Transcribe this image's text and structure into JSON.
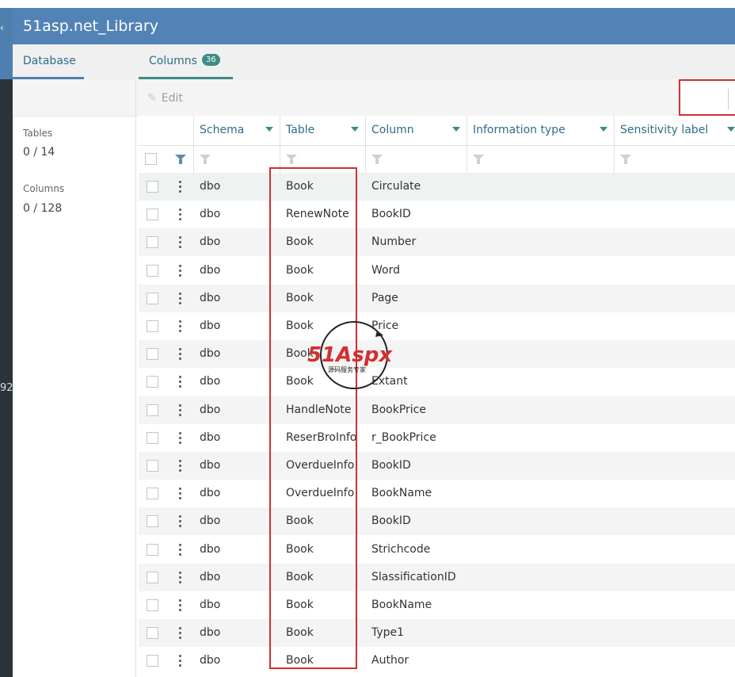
{
  "app": {
    "title": "51asp.net_Library"
  },
  "leftbar": {
    "chevron": "‹",
    "partial_number": "92"
  },
  "tabs": [
    {
      "label": "Database"
    },
    {
      "label": "Columns",
      "badge": "36"
    }
  ],
  "sidebar": {
    "tables_label": "Tables",
    "tables_value": "0 / 14",
    "columns_label": "Columns",
    "columns_value": "0 / 128"
  },
  "toolbar": {
    "edit_label": "Edit"
  },
  "grid": {
    "headers": [
      "Schema",
      "Table",
      "Column",
      "Information type",
      "Sensitivity label"
    ],
    "rows": [
      {
        "schema": "dbo",
        "table": "Book",
        "column": "Circulate"
      },
      {
        "schema": "dbo",
        "table": "RenewNote",
        "column": "BookID"
      },
      {
        "schema": "dbo",
        "table": "Book",
        "column": "Number"
      },
      {
        "schema": "dbo",
        "table": "Book",
        "column": "Word"
      },
      {
        "schema": "dbo",
        "table": "Book",
        "column": "Page"
      },
      {
        "schema": "dbo",
        "table": "Book",
        "column": "Price"
      },
      {
        "schema": "dbo",
        "table": "Book",
        "column": ""
      },
      {
        "schema": "dbo",
        "table": "Book",
        "column": "Extant"
      },
      {
        "schema": "dbo",
        "table": "HandleNote",
        "column": "BookPrice"
      },
      {
        "schema": "dbo",
        "table": "ReserBroInfo",
        "column": "r_BookPrice"
      },
      {
        "schema": "dbo",
        "table": "OverdueInfo",
        "column": "BookID"
      },
      {
        "schema": "dbo",
        "table": "OverdueInfo",
        "column": "BookName"
      },
      {
        "schema": "dbo",
        "table": "Book",
        "column": "BookID"
      },
      {
        "schema": "dbo",
        "table": "Book",
        "column": "Strichcode"
      },
      {
        "schema": "dbo",
        "table": "Book",
        "column": "SlassificationID"
      },
      {
        "schema": "dbo",
        "table": "Book",
        "column": "BookName"
      },
      {
        "schema": "dbo",
        "table": "Book",
        "column": "Type1"
      },
      {
        "schema": "dbo",
        "table": "Book",
        "column": "Author"
      }
    ]
  },
  "watermark": {
    "brand": "51Aspx",
    "tagline": "源码服务专家"
  }
}
